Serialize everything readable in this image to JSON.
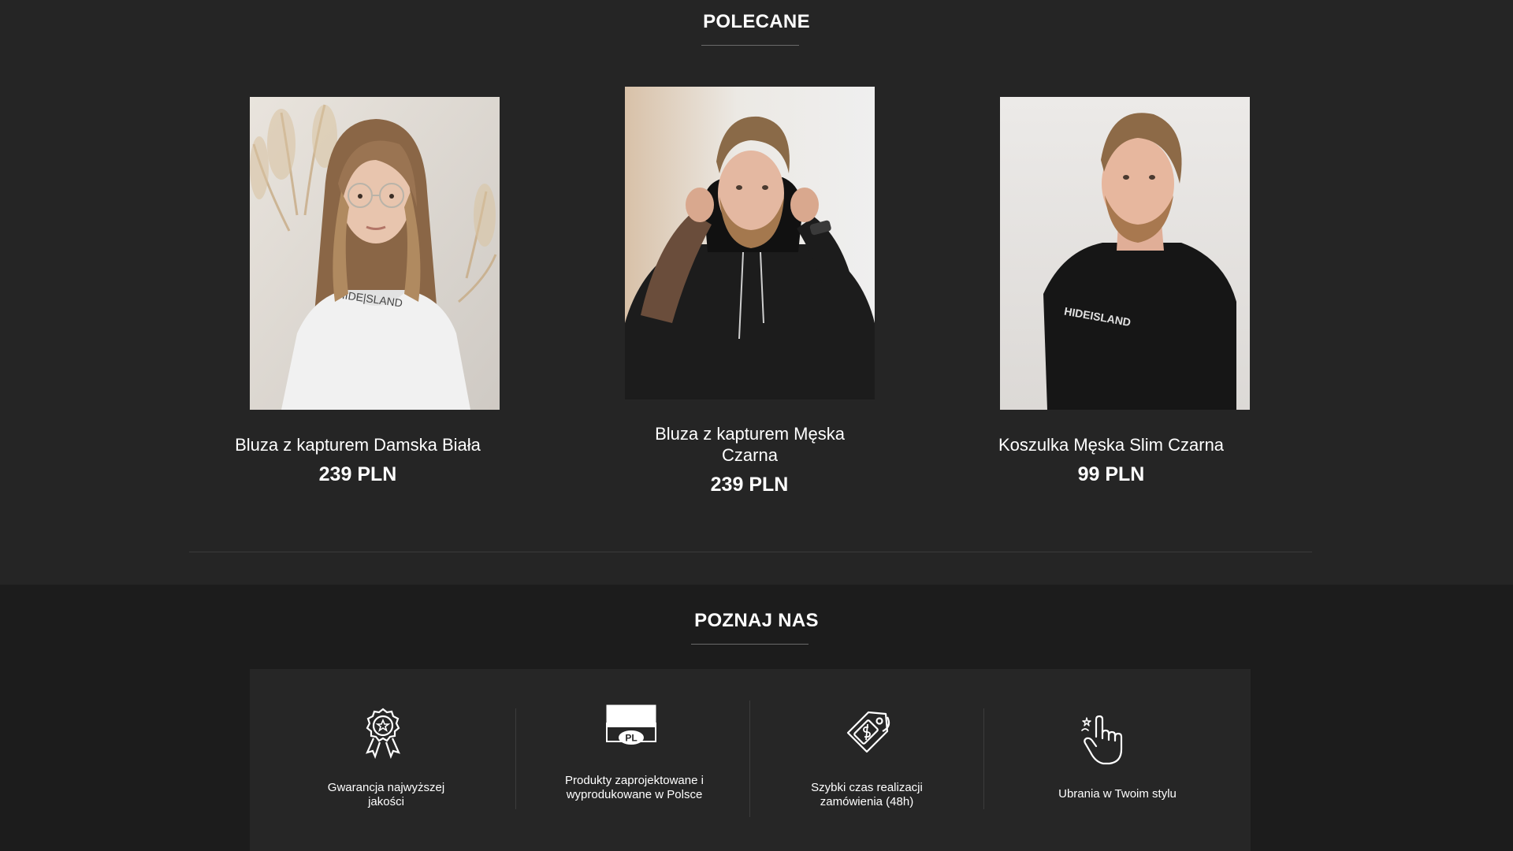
{
  "featured": {
    "title": "POLECANE",
    "products": [
      {
        "name": "Bluza z kapturem Damska Biała",
        "price": "239 PLN"
      },
      {
        "name": "Bluza z kapturem Męska Czarna",
        "price": "239 PLN"
      },
      {
        "name": "Koszulka Męska Slim Czarna",
        "price": "99 PLN",
        "shirt_print": "HIDEISLAND"
      }
    ]
  },
  "about": {
    "title": "POZNAJ NAS",
    "features": [
      {
        "icon": "award-rosette-icon",
        "label": "Gwarancja najwyższej jakości"
      },
      {
        "icon": "pl-flag-icon",
        "label": "Produkty zaprojektowane i wyprodukowane w Polsce",
        "badge": "PL"
      },
      {
        "icon": "price-tag-icon",
        "label": "Szybki czas realizacji zamówienia (48h)"
      },
      {
        "icon": "hand-pointer-icon",
        "label": "Ubrania w Twoim stylu"
      }
    ]
  },
  "colors": {
    "background": "#252525",
    "about_background": "#1c1c1c",
    "features_panel": "#262626",
    "text": "#ffffff"
  }
}
